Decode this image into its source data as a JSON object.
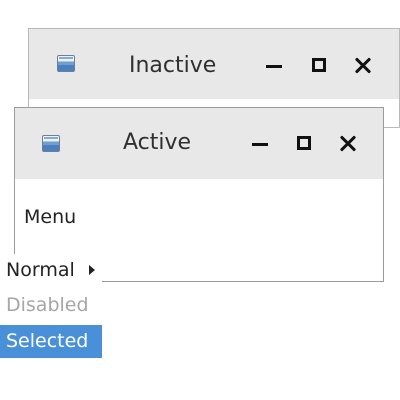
{
  "windows": {
    "inactive": {
      "title": "Inactive",
      "state": "inactive",
      "icon": "application-window-icon",
      "controls": [
        "minimize-icon",
        "maximize-icon",
        "close-icon"
      ]
    },
    "active": {
      "title": "Active",
      "state": "active",
      "icon": "application-window-icon",
      "controls": [
        "minimize-icon",
        "maximize-icon",
        "close-icon"
      ]
    }
  },
  "menu": {
    "title": "Menu",
    "items": [
      {
        "label": "Normal",
        "state": "normal",
        "submenu": true
      },
      {
        "label": "Disabled",
        "state": "disabled"
      },
      {
        "label": "Selected",
        "state": "selected"
      }
    ]
  },
  "colors": {
    "titlebar": "#e8e8e8",
    "window_border": "#9b9b9b",
    "text": "#222222",
    "disabled_text": "#a6a6a6",
    "selected_background": "#4a90d9",
    "selected_text": "#ffffff"
  }
}
